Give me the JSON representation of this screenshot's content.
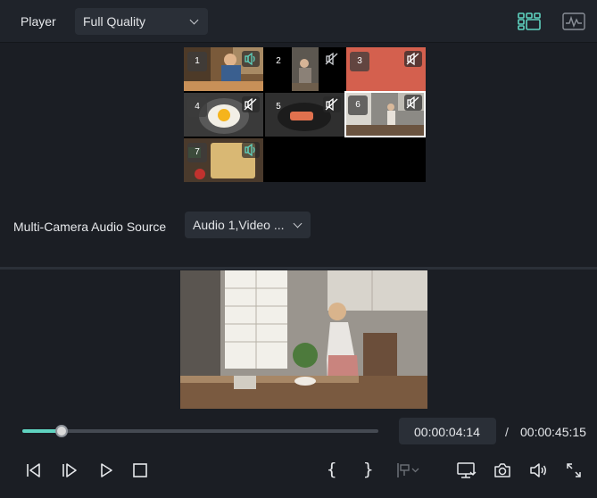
{
  "header": {
    "title": "Player",
    "quality": {
      "value": "Full Quality"
    },
    "icons": [
      "multicam-grid-icon",
      "audio-waveform-icon"
    ]
  },
  "multicam": {
    "cameras": [
      {
        "number": "1",
        "audio": "on"
      },
      {
        "number": "2",
        "audio": "muted"
      },
      {
        "number": "3",
        "audio": "muted"
      },
      {
        "number": "4",
        "audio": "muted"
      },
      {
        "number": "5",
        "audio": "muted"
      },
      {
        "number": "6",
        "audio": "muted",
        "selected": true
      },
      {
        "number": "7",
        "audio": "on"
      }
    ],
    "audio_source": {
      "label": "Multi-Camera Audio Source",
      "value": "Audio 1,Video ..."
    }
  },
  "playback": {
    "progress_fraction": 0.11,
    "current_time": "00:00:04:14",
    "separator": "/",
    "total_time": "00:00:45:15"
  },
  "colors": {
    "accent": "#5fd3c0",
    "background": "#1b1e24",
    "panel": "#2a2f37"
  }
}
